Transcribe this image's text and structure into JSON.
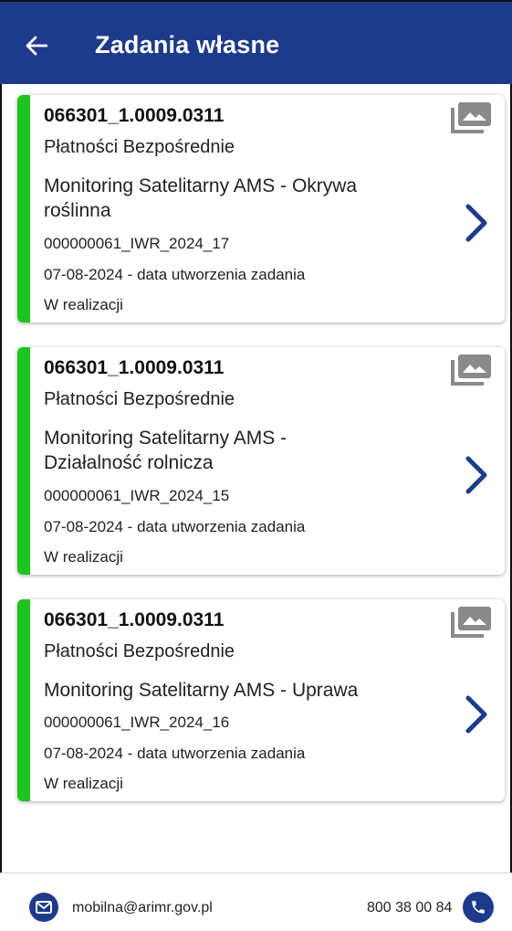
{
  "header": {
    "title": "Zadania własne",
    "back_icon": "arrow-left-icon"
  },
  "tasks": [
    {
      "code": "066301_1.0009.0311",
      "program": "Płatności Bezpośrednie",
      "name": "Monitoring Satelitarny AMS - Okrywa roślinna",
      "ref": "000000061_IWR_2024_17",
      "date": "07-08-2024 - data utworzenia zadania",
      "status": "W realizacji"
    },
    {
      "code": "066301_1.0009.0311",
      "program": "Płatności Bezpośrednie",
      "name": "Monitoring Satelitarny AMS - Działalność rolnicza",
      "ref": "000000061_IWR_2024_15",
      "date": "07-08-2024 - data utworzenia zadania",
      "status": "W realizacji"
    },
    {
      "code": "066301_1.0009.0311",
      "program": "Płatności Bezpośrednie",
      "name": "Monitoring Satelitarny AMS - Uprawa",
      "ref": "000000061_IWR_2024_16",
      "date": "07-08-2024 - data utworzenia zadania",
      "status": "W realizacji"
    }
  ],
  "footer": {
    "email": "mobilna@arimr.gov.pl",
    "phone": "800 38 00 84"
  },
  "colors": {
    "primary": "#1e3a8a",
    "accent_green": "#1ec51e",
    "icon_gray": "#8a8a8a"
  }
}
